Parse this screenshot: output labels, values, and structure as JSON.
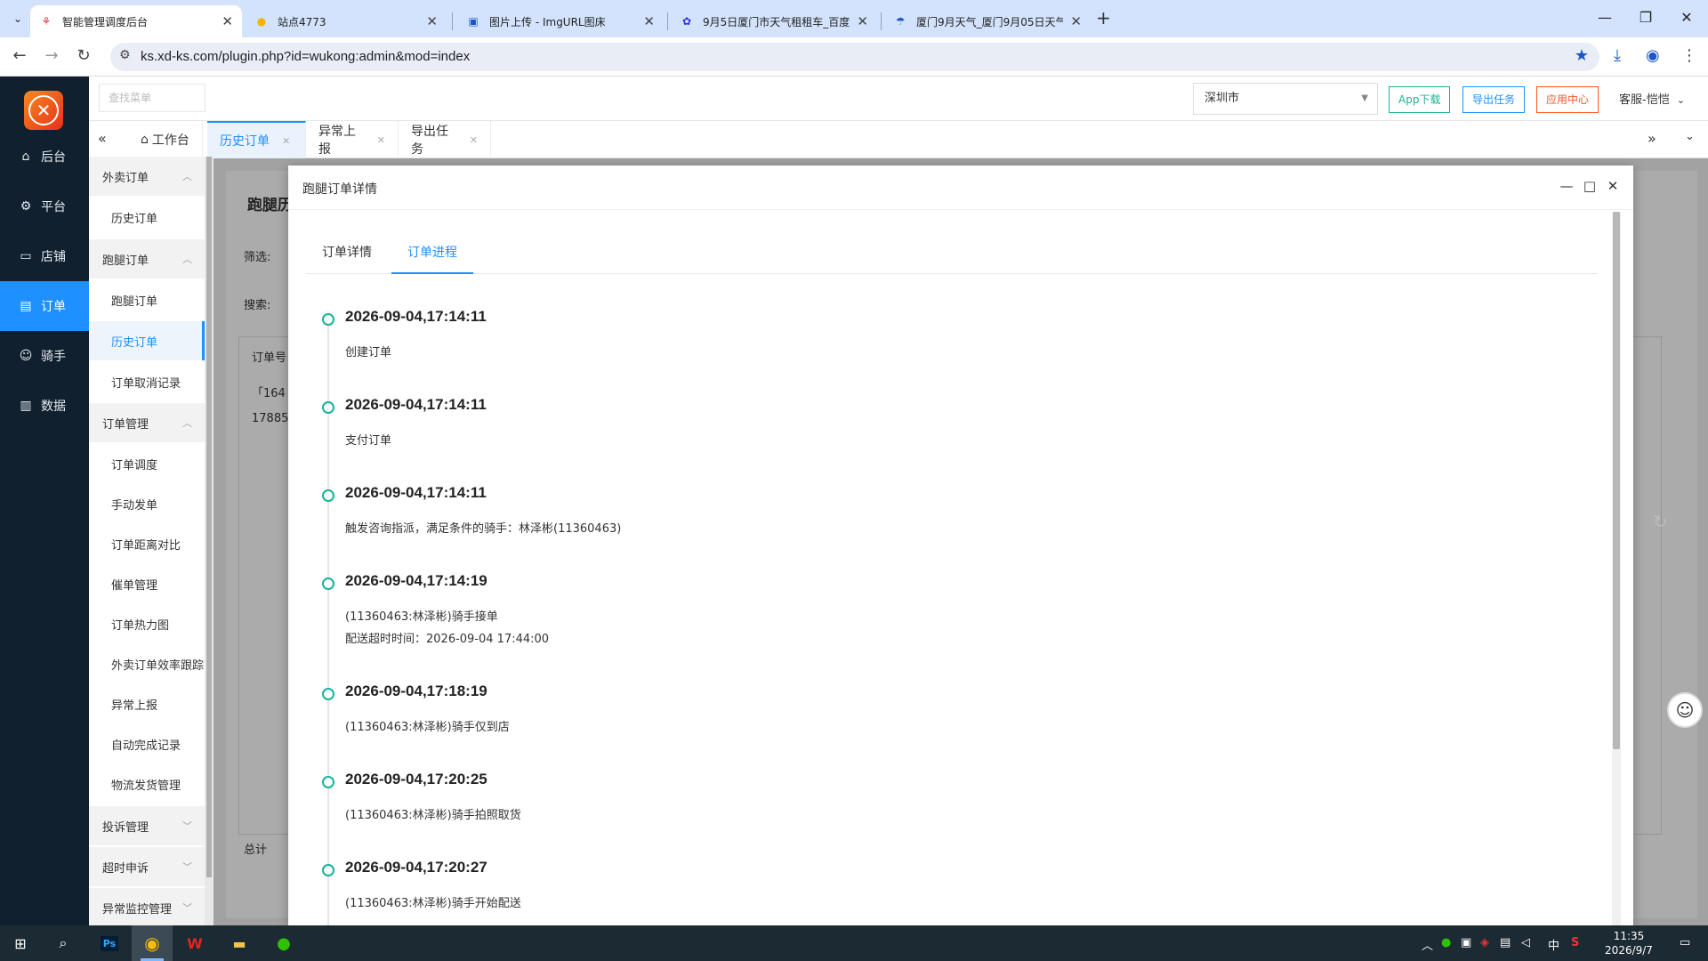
{
  "browser": {
    "tabs": [
      {
        "title": "智能管理调度后台",
        "active": true
      },
      {
        "title": "站点4773",
        "active": false
      },
      {
        "title": "图片上传 - ImgURL图床",
        "active": false
      },
      {
        "title": "9月5日厦门市天气租租车_百度",
        "active": false
      },
      {
        "title": "厦门9月天气_厦门9月05日天气",
        "active": false
      }
    ],
    "url": "ks.xd-ks.com/plugin.php?id=wukong:admin&mod=index"
  },
  "leftnav": {
    "items": [
      {
        "label": "后台",
        "icon": "home-icon"
      },
      {
        "label": "平台",
        "icon": "gear-icon"
      },
      {
        "label": "店铺",
        "icon": "store-icon"
      },
      {
        "label": "订单",
        "icon": "document-icon"
      },
      {
        "label": "骑手",
        "icon": "user-icon"
      },
      {
        "label": "数据",
        "icon": "bar-chart-icon"
      }
    ]
  },
  "submenu": {
    "search_placeholder": "查找菜单",
    "groups": {
      "g1": "外卖订单",
      "g2": "跑腿订单",
      "g3": "订单管理",
      "g4": "投诉管理",
      "g5": "超时申诉",
      "g6": "异常监控管理"
    },
    "items": {
      "i1": "历史订单",
      "i2": "跑腿订单",
      "i3": "历史订单",
      "i4": "订单取消记录",
      "i5": "订单调度",
      "i6": "手动发单",
      "i7": "订单距离对比",
      "i8": "催单管理",
      "i9": "订单热力图",
      "i10": "外卖订单效率跟踪",
      "i11": "异常上报",
      "i12": "自动完成记录",
      "i13": "物流发货管理"
    }
  },
  "topbar": {
    "city": "深圳市",
    "btn_app": "App下载",
    "btn_export": "导出任务",
    "btn_appcenter": "应用中心",
    "user": "客服-恺恺"
  },
  "pagetabs": {
    "workbench": "工作台",
    "history": "历史订单",
    "abnormal": "异常上报",
    "export": "导出任务"
  },
  "bgpage": {
    "title": "跑腿历",
    "filter": "筛选:",
    "search": "搜索:",
    "col_order": "订单号",
    "cell1": "「164",
    "cell2": "17885",
    "total": "总计"
  },
  "modal": {
    "title": "跑腿订单详情",
    "tabs": [
      "订单详情",
      "订单进程"
    ],
    "active_tab": 1,
    "timeline": [
      {
        "time": "2026-09-04,17:14:11",
        "lines": [
          "创建订单"
        ]
      },
      {
        "time": "2026-09-04,17:14:11",
        "lines": [
          "支付订单"
        ]
      },
      {
        "time": "2026-09-04,17:14:11",
        "lines": [
          "触发咨询指派，满足条件的骑手：林泽彬(11360463)"
        ]
      },
      {
        "time": "2026-09-04,17:14:19",
        "lines": [
          "(11360463:林泽彬)骑手接单",
          "配送超时时间：2026-09-04 17:44:00"
        ]
      },
      {
        "time": "2026-09-04,17:18:19",
        "lines": [
          "(11360463:林泽彬)骑手仅到店"
        ]
      },
      {
        "time": "2026-09-04,17:20:25",
        "lines": [
          "(11360463:林泽彬)骑手拍照取货"
        ]
      },
      {
        "time": "2026-09-04,17:20:27",
        "lines": [
          "(11360463:林泽彬)骑手开始配送"
        ]
      }
    ]
  },
  "taskbar": {
    "time": "11:35",
    "date": "2026/9/7",
    "ime": "中"
  },
  "colors": {
    "accent": "#1e90ff",
    "nav_bg": "#10202e",
    "timeline_dot": "#16b39a",
    "btn_teal": "#1bb394",
    "btn_blue": "#1e90ff",
    "btn_orange": "#ff5722"
  }
}
